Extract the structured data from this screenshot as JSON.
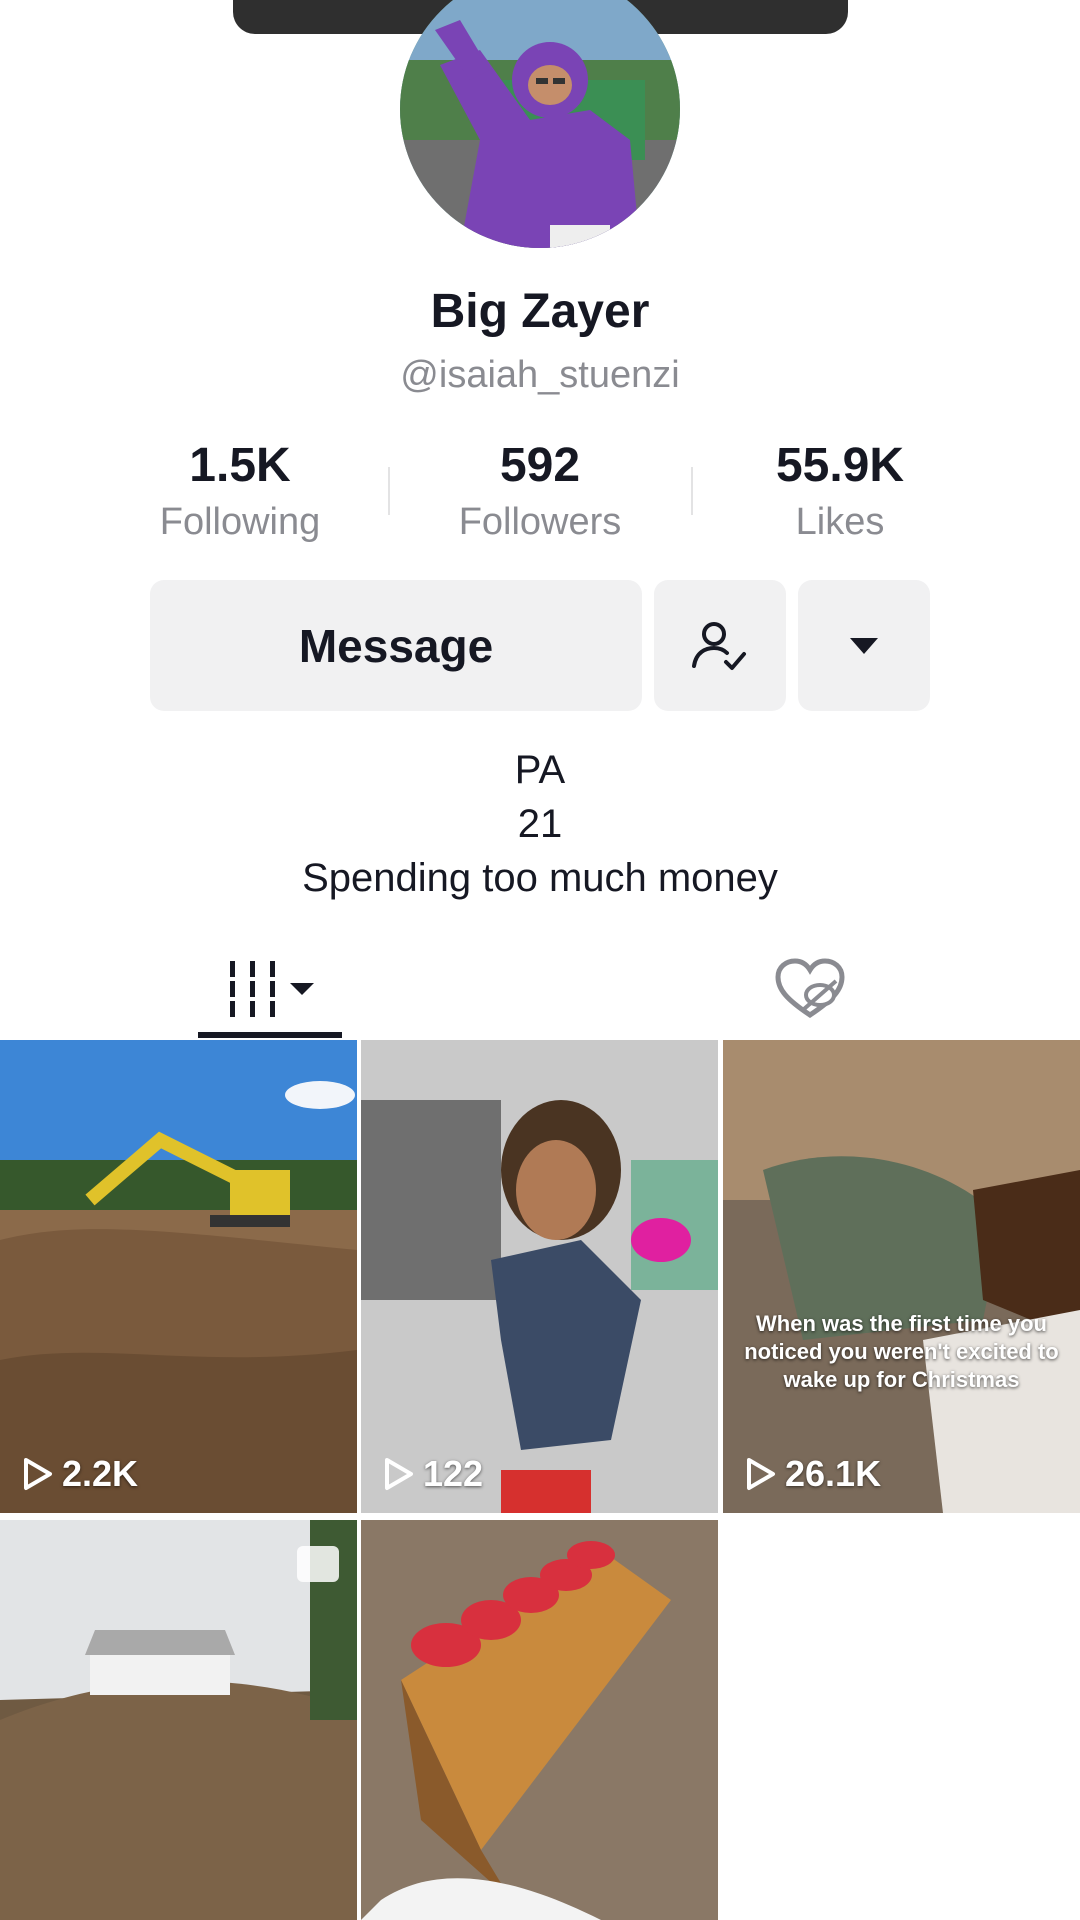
{
  "profile": {
    "display_name": "Big Zayer",
    "handle": "@isaiah_stuenzi"
  },
  "stats": [
    {
      "value": "1.5K",
      "label": "Following"
    },
    {
      "value": "592",
      "label": "Followers"
    },
    {
      "value": "55.9K",
      "label": "Likes"
    }
  ],
  "actions": {
    "message_label": "Message",
    "following_icon": "user-check-icon",
    "more_icon": "caret-down-icon"
  },
  "bio": {
    "line1": "PA",
    "line2": "21",
    "line3": "Spending too much money"
  },
  "tabs": {
    "videos_icon": "grid-icon",
    "liked_icon": "hidden-heart-icon"
  },
  "videos": [
    {
      "views": "2.2K",
      "caption": ""
    },
    {
      "views": "122",
      "caption": ""
    },
    {
      "views": "26.1K",
      "caption": "When was the first time you noticed you weren't excited to wake up for Christmas"
    },
    {
      "views": "",
      "caption": ""
    },
    {
      "views": "",
      "caption": ""
    }
  ],
  "colors": {
    "text": "#161823",
    "secondary_text": "#8a8b91",
    "button_bg": "#f1f1f2"
  }
}
